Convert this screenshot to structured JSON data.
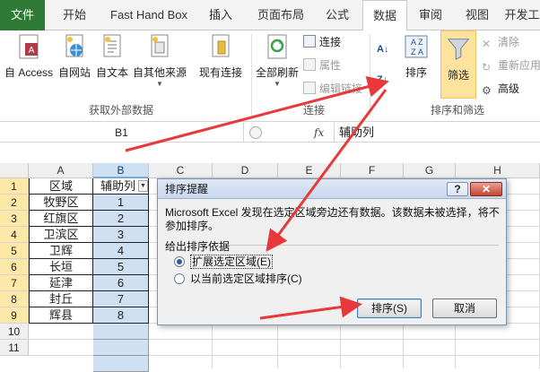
{
  "tabs": [
    {
      "label": "文件",
      "key": "file"
    },
    {
      "label": "开始",
      "key": "home"
    },
    {
      "label": "Fast Hand Box",
      "key": "fasthandbox"
    },
    {
      "label": "插入",
      "key": "insert"
    },
    {
      "label": "页面布局",
      "key": "pagelayout"
    },
    {
      "label": "公式",
      "key": "formulas"
    },
    {
      "label": "数据",
      "key": "data"
    },
    {
      "label": "审阅",
      "key": "review"
    },
    {
      "label": "视图",
      "key": "view"
    },
    {
      "label": "开发工",
      "key": "developer"
    }
  ],
  "ribbon": {
    "external_data": {
      "from_access": "自 Access",
      "from_web": "自网站",
      "from_text": "自文本",
      "from_other": "自其他来源",
      "existing_connections": "现有连接",
      "group_label": "获取外部数据"
    },
    "connections": {
      "refresh_all": "全部刷新",
      "connections": "连接",
      "properties": "属性",
      "edit_links": "编辑链接",
      "group_label": "连接"
    },
    "sort_filter": {
      "sort": "排序",
      "filter": "筛选",
      "clear": "清除",
      "reapply": "重新应用",
      "advanced": "高级",
      "group_label": "排序和筛选"
    }
  },
  "formula_bar": {
    "name_box": "B1",
    "fx": "fx",
    "content": "辅助列"
  },
  "sheet": {
    "columns": [
      "A",
      "B",
      "C",
      "D",
      "E",
      "F",
      "G",
      "H"
    ],
    "rows": [
      "1",
      "2",
      "3",
      "4",
      "5",
      "6",
      "7",
      "8",
      "9",
      "10",
      "11"
    ],
    "colA": [
      "区域",
      "牧野区",
      "红旗区",
      "卫滨区",
      "卫辉",
      "长垣",
      "延津",
      "封丘",
      "辉县"
    ],
    "colB": [
      "辅助列",
      "1",
      "2",
      "3",
      "4",
      "5",
      "6",
      "7",
      "8"
    ]
  },
  "dialog": {
    "title": "排序提醒",
    "help": "?",
    "close": "✕",
    "message": "Microsoft Excel 发现在选定区域旁边还有数据。该数据未被选择，将不参加排序。",
    "section_label": "给出排序依据",
    "option_expand": "扩展选定区域(E)",
    "option_current": "以当前选定区域排序(C)",
    "sort_button": "排序(S)",
    "cancel_button": "取消"
  },
  "colors": {
    "file_tab": "#2f7b36",
    "selection": "#cfe0f3",
    "arrow": "#e8383a",
    "filter_active": "#fde39e"
  }
}
